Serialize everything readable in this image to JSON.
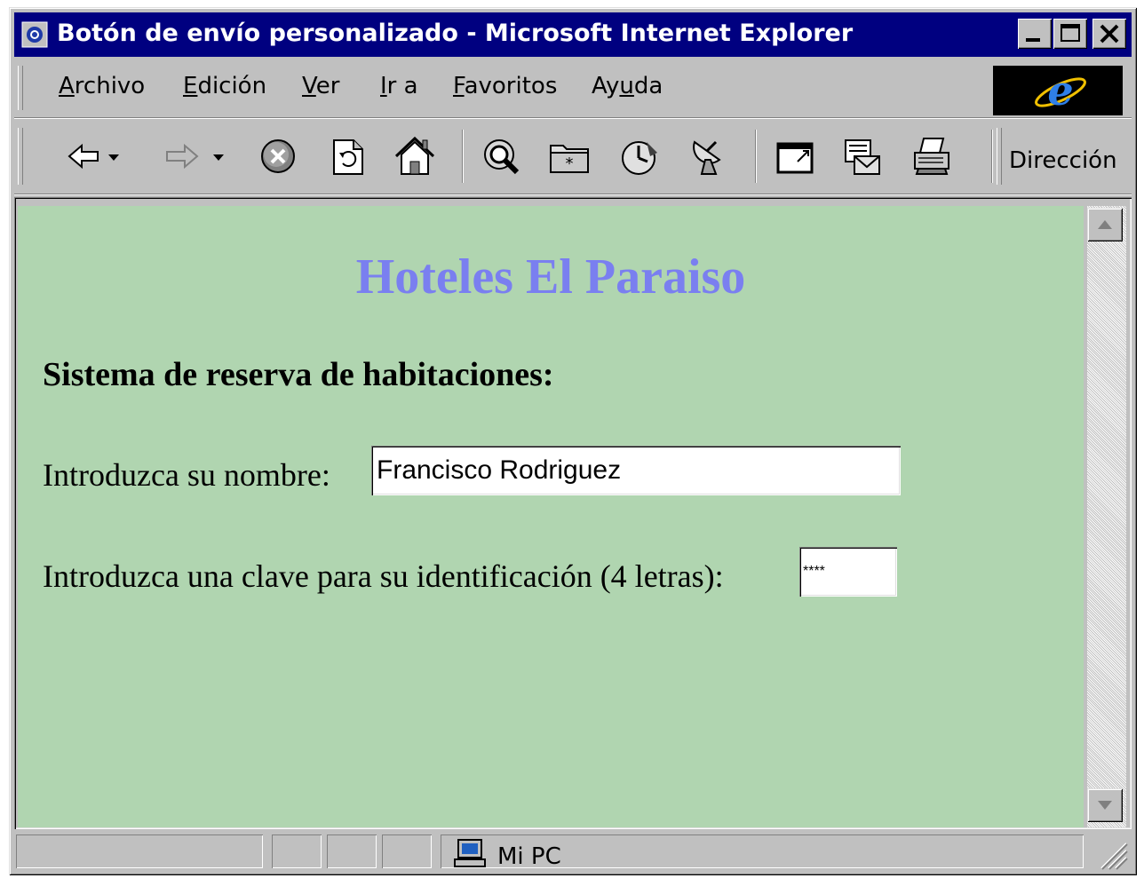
{
  "window": {
    "title": "Botón de envío personalizado - Microsoft Internet Explorer"
  },
  "menubar": {
    "items": [
      {
        "pre": "",
        "u": "A",
        "post": "rchivo"
      },
      {
        "pre": "",
        "u": "E",
        "post": "dición"
      },
      {
        "pre": "",
        "u": "V",
        "post": "er"
      },
      {
        "pre": "",
        "u": "I",
        "post": "r a"
      },
      {
        "pre": "",
        "u": "F",
        "post": "avoritos"
      },
      {
        "pre": "Ay",
        "u": "u",
        "post": "da"
      }
    ]
  },
  "toolbar": {
    "address_label": "Dirección",
    "icons": [
      "back-icon",
      "forward-icon",
      "stop-icon",
      "refresh-icon",
      "home-icon",
      "search-icon",
      "favorites-icon",
      "history-icon",
      "channels-icon",
      "fullscreen-icon",
      "mail-icon",
      "print-icon"
    ]
  },
  "page": {
    "heading": "Hoteles El Paraiso",
    "heading_color": "#7a7ff0",
    "background_color": "#b0d5b0",
    "subheading": "Sistema de reserva de habitaciones:",
    "name_label": "Introduzca su nombre:",
    "name_value": "Francisco Rodriguez",
    "password_label": "Introduzca una clave para su identificación (4 letras):",
    "password_value": "****"
  },
  "statusbar": {
    "zone_text": "Mi PC"
  }
}
